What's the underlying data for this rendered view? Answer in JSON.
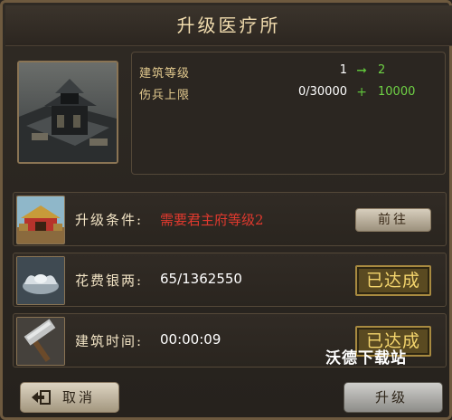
{
  "title": "升级医疗所",
  "stats": [
    {
      "label": "建筑等级",
      "current": "1",
      "operator": "➞",
      "next": "2"
    },
    {
      "label": "伤兵上限",
      "current": "0/30000",
      "operator": "+",
      "next": "10000"
    }
  ],
  "requirements": [
    {
      "icon": "palace-icon",
      "label": "升级条件:",
      "value": "需要君主府等级2",
      "action": "前往"
    },
    {
      "icon": "silver-ingot-icon",
      "label": "花费银两:",
      "value": "65/1362550",
      "status": "已达成"
    },
    {
      "icon": "hammer-icon",
      "label": "建筑时间:",
      "value": "00:00:09",
      "status": "已达成"
    }
  ],
  "watermark": "沃德下载站",
  "buttons": {
    "cancel": "取消",
    "upgrade": "升级"
  },
  "colors": {
    "accent_gold": "#f4d56d",
    "warning_red": "#e0392e",
    "increase_green": "#6fd245"
  }
}
